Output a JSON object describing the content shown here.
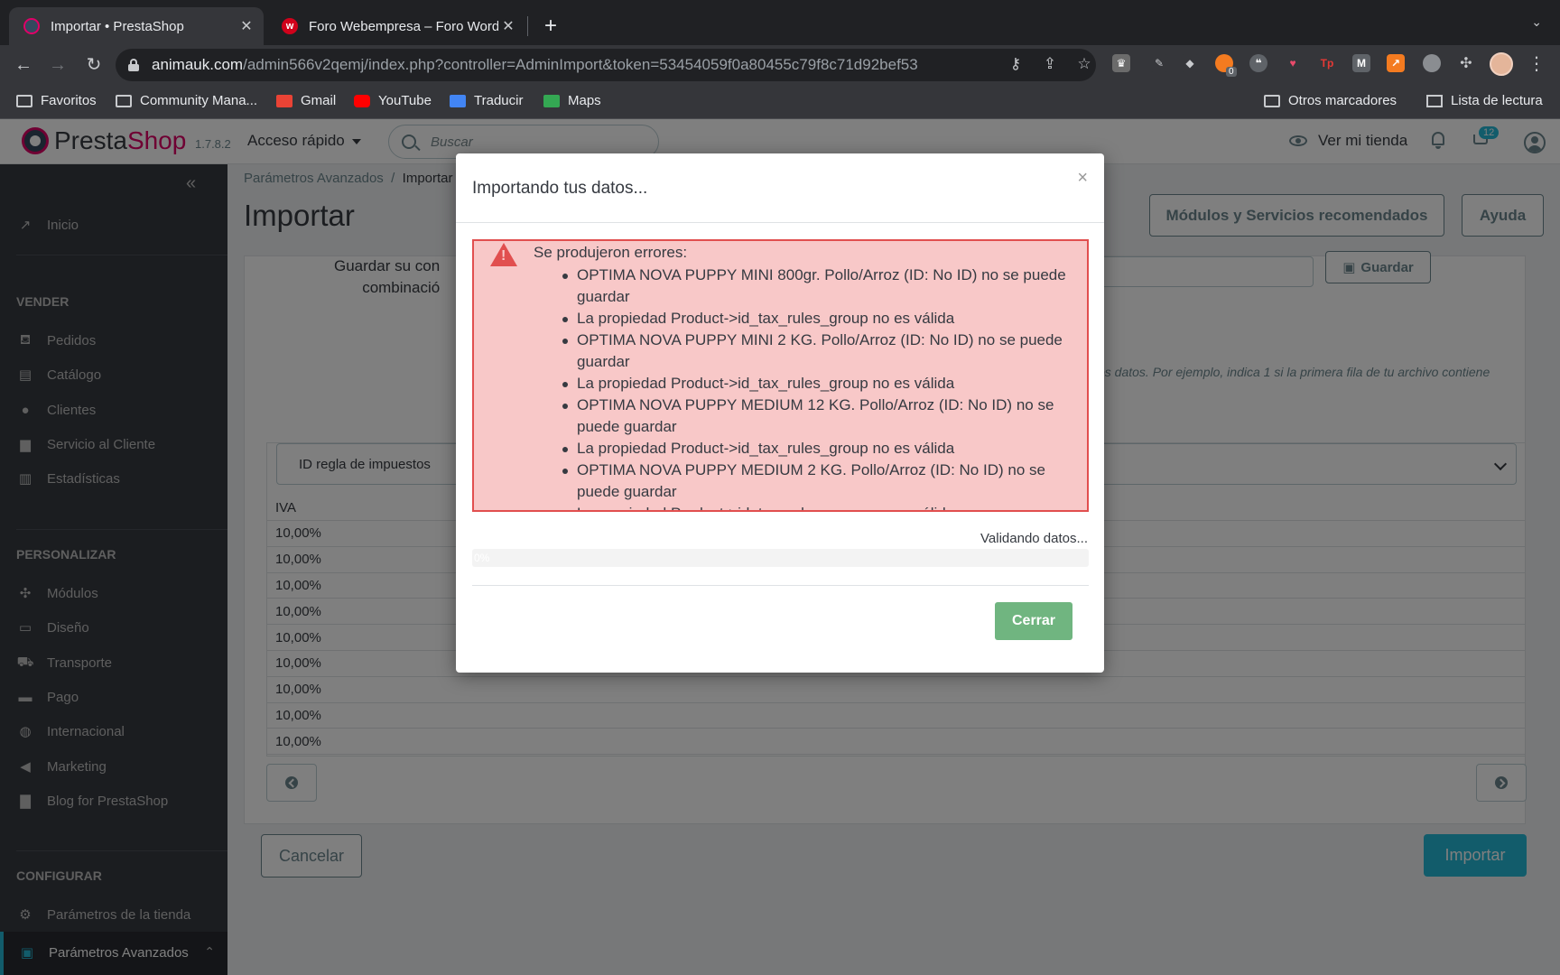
{
  "browser": {
    "tabs": [
      {
        "title": "Importar • PrestaShop",
        "active": true
      },
      {
        "title": "Foro Webempresa – Foro WordPress",
        "active": false
      }
    ],
    "url_domain": "animauk.com",
    "url_path": "/admin566v2qemj/index.php?controller=AdminImport&token=53454059f0a80455c79f8c71d92bef53",
    "extension_badge": "0",
    "bookmarks": [
      "Favoritos",
      "Community Mana...",
      "Gmail",
      "YouTube",
      "Traducir",
      "Maps"
    ],
    "bookmarks_right": [
      "Otros marcadores",
      "Lista de lectura"
    ]
  },
  "header": {
    "logo_a": "Presta",
    "logo_b": "Shop",
    "version": "1.7.8.2",
    "quick_access": "Acceso rápido",
    "search_placeholder": "Buscar",
    "view_store": "Ver mi tienda",
    "cart_badge": "12"
  },
  "sidebar": {
    "home": "Inicio",
    "sections": [
      {
        "title": "VENDER",
        "items": [
          "Pedidos",
          "Catálogo",
          "Clientes",
          "Servicio al Cliente",
          "Estadísticas"
        ]
      },
      {
        "title": "PERSONALIZAR",
        "items": [
          "Módulos",
          "Diseño",
          "Transporte",
          "Pago",
          "Internacional",
          "Marketing",
          "Blog for PrestaShop"
        ]
      },
      {
        "title": "CONFIGURAR",
        "items": [
          "Parámetros de la tienda",
          "Parámetros Avanzados"
        ]
      }
    ]
  },
  "page": {
    "breadcrumb_parent": "Parámetros Avanzados",
    "breadcrumb_current": "Importar",
    "title": "Importar",
    "btn_modules": "Módulos y Servicios recomendados",
    "btn_help": "Ayuda",
    "save_text_1": "Guardar su con",
    "save_text_2": "combinació",
    "save_button": "Guardar",
    "help_text": "os datos. Por ejemplo, indica 1 si la primera fila de tu archivo contiene",
    "select_value": "ID regla de impuestos",
    "table_header": "IVA",
    "table_rows": [
      "10,00%",
      "10,00%",
      "10,00%",
      "10,00%",
      "10,00%",
      "10,00%",
      "10,00%",
      "10,00%",
      "10,00%"
    ],
    "cancel": "Cancelar",
    "import": "Importar"
  },
  "modal": {
    "title": "Importando tus datos...",
    "close": "×",
    "alert_heading": "Se produjeron errores:",
    "errors": [
      "OPTIMA NOVA PUPPY MINI 800gr. Pollo/Arroz (ID: No ID) no se puede guardar",
      "La propiedad Product->id_tax_rules_group no es válida",
      "OPTIMA NOVA PUPPY MINI 2 KG. Pollo/Arroz (ID: No ID) no se puede guardar",
      "La propiedad Product->id_tax_rules_group no es válida",
      "OPTIMA NOVA PUPPY MEDIUM 12 KG. Pollo/Arroz (ID: No ID) no se puede guardar",
      "La propiedad Product->id_tax_rules_group no es válida",
      "OPTIMA NOVA PUPPY MEDIUM 2 KG. Pollo/Arroz (ID: No ID) no se puede guardar",
      "La propiedad Product->id_tax_rules_group no es válida"
    ],
    "status": "Validando datos...",
    "progress_label": "0%",
    "progress_fraction": 0,
    "button": "Cerrar"
  },
  "colors": {
    "accent": "#25b9d7",
    "brand": "#df0067",
    "error_bg": "#f8c8c8",
    "error_border": "#e14f4f",
    "success": "#70b580",
    "sidebar": "#363a41"
  }
}
